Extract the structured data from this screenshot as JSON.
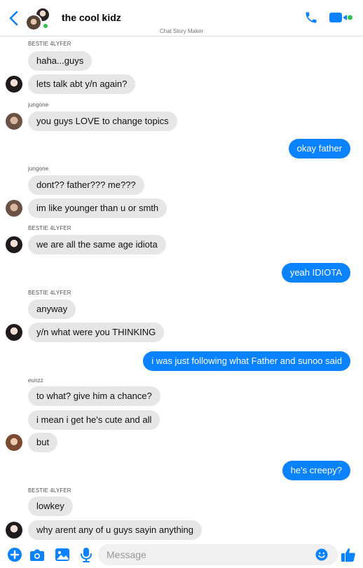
{
  "header": {
    "title": "the cool kidz",
    "subtitle": "Chat Story Maker",
    "accent": "#0b82ff",
    "online_color": "#31c24d"
  },
  "messages": [
    {
      "sender": "BESTIE 4LYFER",
      "text": "haha...guys",
      "dir": "in"
    },
    {
      "text": "lets talk abt y/n again?",
      "dir": "in",
      "avatar": "bestie"
    },
    {
      "sender": "jungone",
      "text": "you guys LOVE to change topics",
      "dir": "in",
      "avatar": "jungone"
    },
    {
      "text": "okay father",
      "dir": "out"
    },
    {
      "sender": "jungone",
      "text": "dont?? father??? me???",
      "dir": "in"
    },
    {
      "text": "im like younger than u or smth",
      "dir": "in",
      "avatar": "jungone"
    },
    {
      "sender": "BESTIE 4LYFER",
      "text": "we are all the same age idiota",
      "dir": "in",
      "avatar": "bestie"
    },
    {
      "text": "yeah IDIOTA",
      "dir": "out"
    },
    {
      "sender": "BESTIE 4LYFER",
      "text": "anyway",
      "dir": "in"
    },
    {
      "text": "y/n what were you THINKING",
      "dir": "in",
      "avatar": "bestie"
    },
    {
      "text": "i was just following what Father and sunoo said",
      "dir": "out"
    },
    {
      "sender": "eunzz",
      "text": "to what? give him a chance?",
      "dir": "in"
    },
    {
      "text": "i mean i get he's cute and all",
      "dir": "in"
    },
    {
      "text": "but",
      "dir": "in",
      "avatar": "eunzz"
    },
    {
      "text": "he's creepy?",
      "dir": "out"
    },
    {
      "sender": "BESTIE 4LYFER",
      "text": "lowkey",
      "dir": "in"
    },
    {
      "text": "why arent any of u guys sayin anything",
      "dir": "in",
      "avatar": "bestie"
    }
  ],
  "composer": {
    "placeholder": "Message"
  },
  "icons": {
    "back": "chevron-left-icon",
    "call": "phone-icon",
    "video": "video-camera-icon",
    "plus": "plus-circle-icon",
    "camera": "camera-icon",
    "gallery": "image-icon",
    "mic": "microphone-icon",
    "emoji": "smiley-icon",
    "like": "thumbs-up-icon"
  }
}
